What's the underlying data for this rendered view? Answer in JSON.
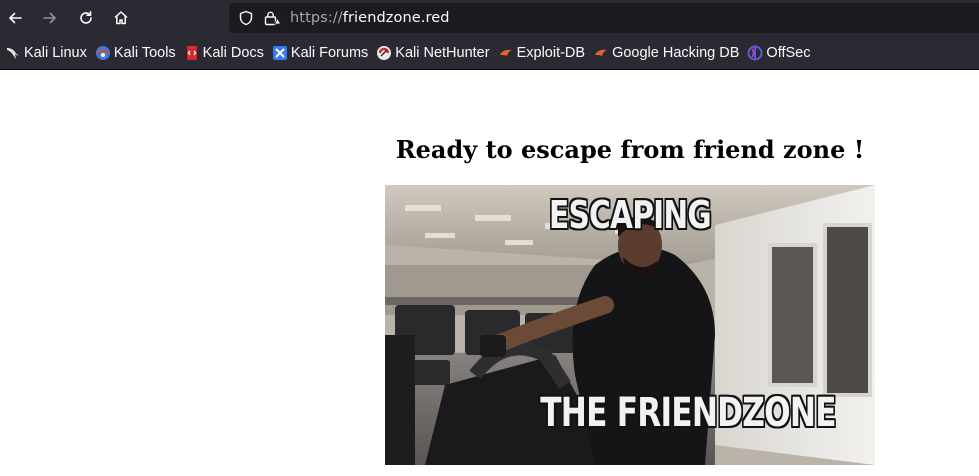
{
  "browser": {
    "url_scheme": "https://",
    "url_host": "friendzone.red",
    "nav": {
      "back_icon": "arrow-left-icon",
      "forward_icon": "arrow-right-icon",
      "reload_icon": "reload-icon",
      "home_icon": "home-icon"
    },
    "bookmarks": [
      {
        "label": "Kali Linux",
        "icon": "kali-dragon-icon"
      },
      {
        "label": "Kali Tools",
        "icon": "kali-tools-icon"
      },
      {
        "label": "Kali Docs",
        "icon": "kali-docs-icon"
      },
      {
        "label": "Kali Forums",
        "icon": "kali-forums-icon"
      },
      {
        "label": "Kali NetHunter",
        "icon": "kali-nethunter-icon"
      },
      {
        "label": "Exploit-DB",
        "icon": "exploit-db-icon"
      },
      {
        "label": "Google Hacking DB",
        "icon": "google-hacking-db-icon"
      },
      {
        "label": "OffSec",
        "icon": "offsec-icon"
      }
    ]
  },
  "page": {
    "heading": "Ready to escape from friend zone !",
    "gif": {
      "caption_top": "ESCAPING",
      "caption_bottom": "THE FRIENDZONE"
    }
  },
  "colors": {
    "toolbar_bg": "#2b2a33",
    "urlbar_bg": "#1c1b22",
    "toolbar_text": "#fbfbfe"
  }
}
